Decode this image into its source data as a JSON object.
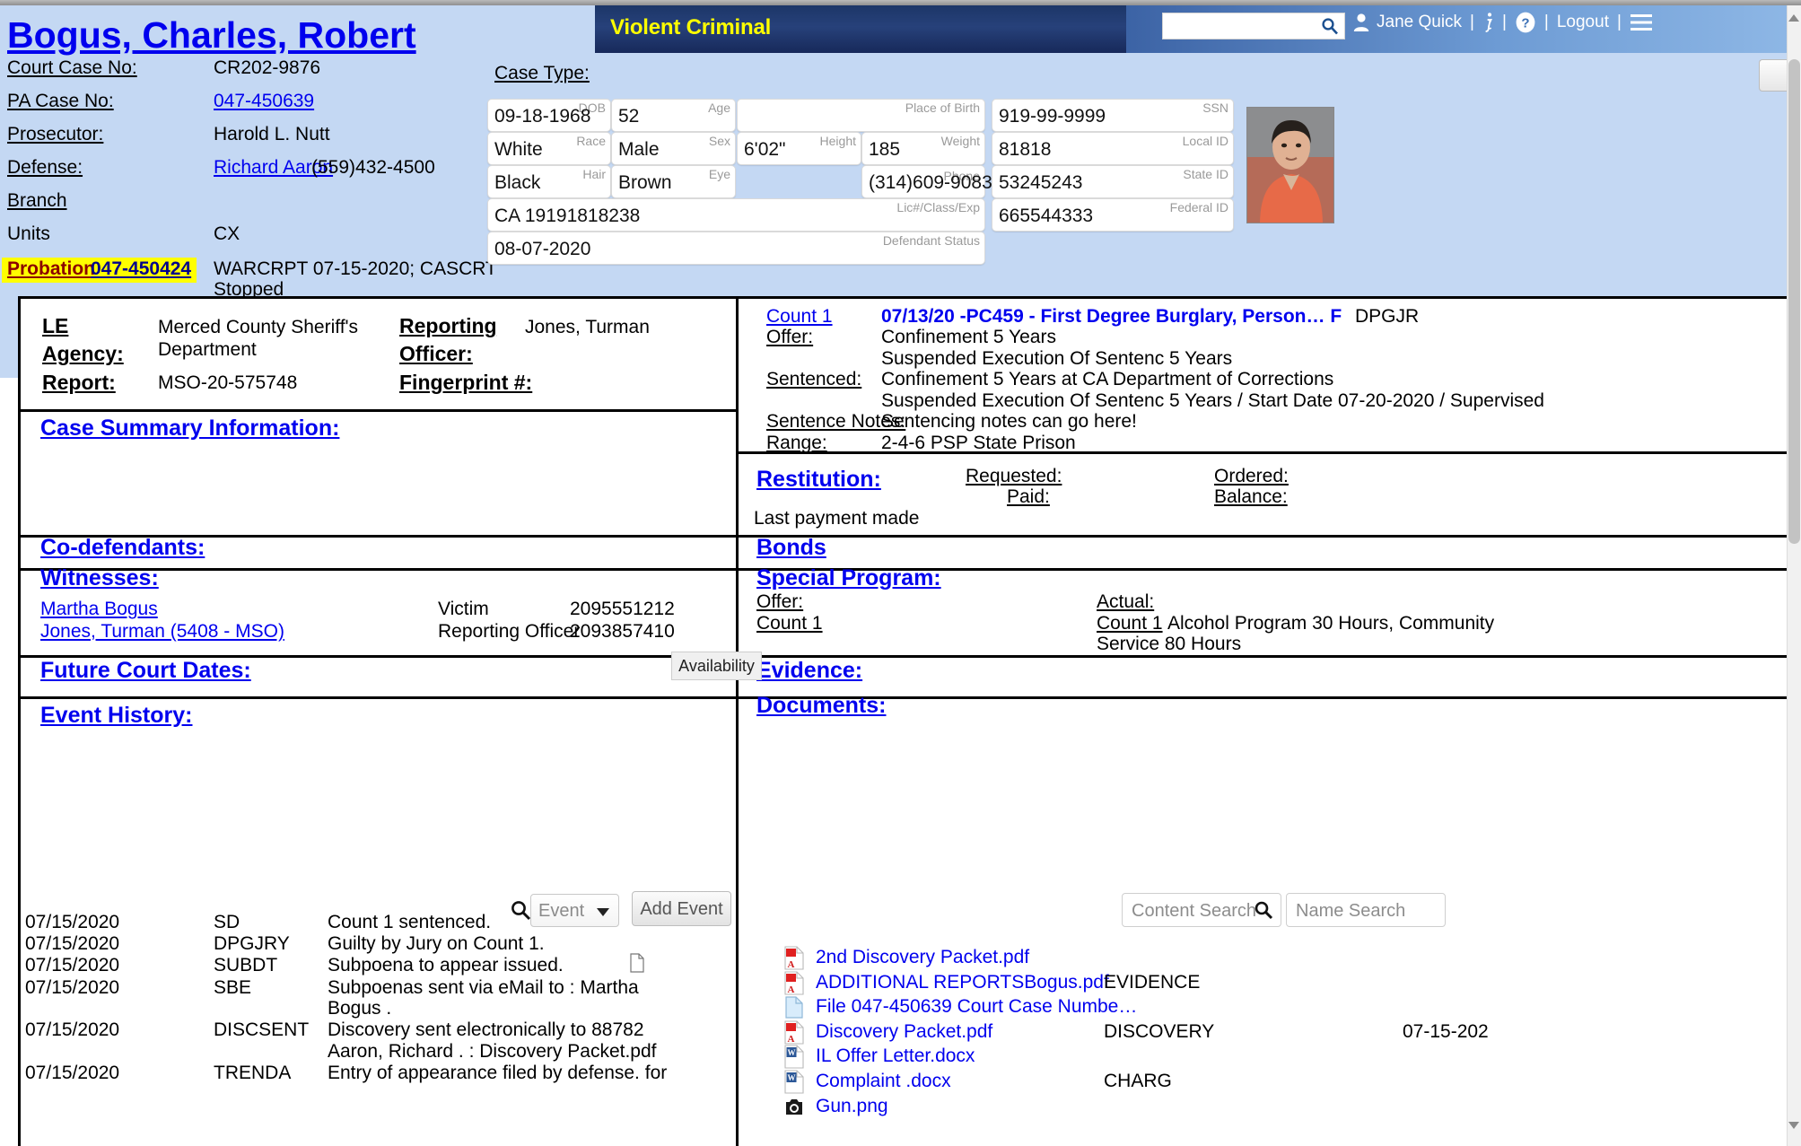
{
  "header": {
    "banner_label": "Violent Criminal",
    "search_placeholder": "",
    "search_value": "",
    "user_name": "Jane Quick",
    "logout_label": "Logout",
    "sep": "|",
    "icons": {
      "search": "search-icon",
      "person": "person-icon",
      "info": "info-icon",
      "help": "help-icon",
      "menu": "hamburger-menu-icon"
    }
  },
  "defendant": {
    "name": "Bogus, Charles, Robert",
    "labels": {
      "court_case_no": "Court Case No:",
      "pa_case_no": "PA Case No:",
      "prosecutor": "Prosecutor:",
      "defense": "Defense:",
      "branch": "Branch",
      "units": "Units",
      "probation": "Probation"
    },
    "values": {
      "court_case_no": "CR202-9876",
      "pa_case_no": "047-450639",
      "prosecutor": "Harold L. Nutt",
      "defense_name": "Richard Aaron",
      "defense_phone": "(559)432-4500",
      "branch": "",
      "units": "CX",
      "probation_no": "047-450424",
      "probation_note_line1": "WARCRPT 07-15-2020; CASCRT",
      "probation_note_line2": "Stopped"
    }
  },
  "case_type": {
    "label": "Case Type:",
    "value": ""
  },
  "demographics": [
    {
      "label": "DOB",
      "value": "09-18-1968"
    },
    {
      "label": "Age",
      "value": "52"
    },
    {
      "label": "Place of Birth",
      "value": ""
    },
    {
      "label": "SSN",
      "value": "919-99-9999"
    },
    {
      "label": "Race",
      "value": "White"
    },
    {
      "label": "Sex",
      "value": "Male"
    },
    {
      "label": "Height",
      "value": "6'02\""
    },
    {
      "label": "Weight",
      "value": "185"
    },
    {
      "label": "Local ID",
      "value": "81818"
    },
    {
      "label": "Hair",
      "value": "Black"
    },
    {
      "label": "Eye",
      "value": "Brown"
    },
    {
      "label": "Phone",
      "value": "(314)609-9083"
    },
    {
      "label": "State ID",
      "value": "53245243"
    },
    {
      "label": "Lic#/Class/Exp",
      "value": "CA 19191818238"
    },
    {
      "label": "Federal ID",
      "value": "665544333"
    },
    {
      "label": "Defendant Status",
      "value": "08-07-2020"
    }
  ],
  "le": {
    "agency_label": "LE Agency:",
    "agency_label_line1": "LE",
    "agency_label_line2": "Agency:",
    "agency_value_line1": "Merced County Sheriff's",
    "agency_value_line2": "Department",
    "report_label": "Report:",
    "report_value": "MSO-20-575748",
    "officer_label_line1": "Reporting",
    "officer_label_line2": "Officer:",
    "officer_value": "Jones, Turman",
    "fingerprint_label": "Fingerprint #:",
    "fingerprint_value": ""
  },
  "case_summary": {
    "heading": "Case Summary Information:",
    "body": ""
  },
  "counts": {
    "count_label": "Count 1",
    "charge": "07/13/20 -PC459 - First Degree Burglary, Person…  F",
    "charge_code": "DPGJR",
    "offer_label": "Offer:",
    "offer_line1": "Confinement 5 Years",
    "offer_line2": "Suspended Execution Of Sentenc 5 Years",
    "sentenced_label": "Sentenced:",
    "sentenced_line1": "Confinement 5 Years at CA Department of Corrections",
    "sentenced_line2": "Suspended Execution Of Sentenc 5 Years / Start Date 07-20-2020 / Supervised",
    "sentence_notes_label": "Sentence Notes:",
    "sentence_notes_value": "Sentencing notes can go here!",
    "range_label": "Range:",
    "range_value": "2-4-6 PSP State Prison"
  },
  "restitution": {
    "heading": "Restitution:",
    "requested_label": "Requested:",
    "ordered_label": "Ordered:",
    "paid_label": "Paid:",
    "balance_label": "Balance:",
    "last_payment_text": "Last payment made",
    "requested_value": "",
    "ordered_value": "",
    "paid_value": "",
    "balance_value": ""
  },
  "codefendants": {
    "heading": "Co-defendants:",
    "rows": []
  },
  "bonds": {
    "heading": "Bonds",
    "rows": []
  },
  "witnesses": {
    "heading": "Witnesses:",
    "rows": [
      {
        "name": "Martha Bogus",
        "role": "Victim",
        "phone": "2095551212"
      },
      {
        "name": "Jones, Turman (5408 - MSO)",
        "role": "Reporting Officer",
        "phone": "2093857410"
      }
    ]
  },
  "special_program": {
    "heading": "Special Program:",
    "offer_label": "Offer:",
    "actual_label": "Actual:",
    "offer_count": "Count 1",
    "actual_count": "Count 1",
    "actual_text_line1": "Alcohol Program 30 Hours, Community",
    "actual_text_line2": "Service 80 Hours"
  },
  "future_court_dates": {
    "heading": "Future Court Dates:"
  },
  "evidence": {
    "heading": "Evidence:"
  },
  "availability_tooltip": "Availability",
  "event_history": {
    "heading": "Event History:",
    "search_icon": "search-icon",
    "select_placeholder": "Event",
    "add_button": "Add Event",
    "rows": [
      {
        "date": "07/15/2020",
        "code": "SD",
        "desc": "Count 1 sentenced.",
        "desc2": "",
        "has_doc": false
      },
      {
        "date": "07/15/2020",
        "code": "DPGJRY",
        "desc": "Guilty by Jury on Count 1.",
        "desc2": "",
        "has_doc": false
      },
      {
        "date": "07/15/2020",
        "code": "SUBDT",
        "desc": "Subpoena to appear issued.",
        "desc2": "",
        "has_doc": true
      },
      {
        "date": "07/15/2020",
        "code": "SBE",
        "desc": "Subpoenas sent via eMail to : Martha",
        "desc2": "Bogus .",
        "has_doc": false
      },
      {
        "date": "07/15/2020",
        "code": "DISCSENT",
        "desc": "Discovery sent electronically to 88782",
        "desc2": "Aaron, Richard . : Discovery Packet.pdf",
        "has_doc": false
      },
      {
        "date": "07/15/2020",
        "code": "TRENDA",
        "desc": "Entry of appearance filed by defense. for",
        "desc2": "",
        "has_doc": false
      }
    ]
  },
  "documents": {
    "heading": "Documents:",
    "content_search_placeholder": "Content Search",
    "name_search_placeholder": "Name Search",
    "rows": [
      {
        "icon": "pdf-icon",
        "name": "2nd Discovery Packet.pdf",
        "category": "",
        "date": ""
      },
      {
        "icon": "pdf-icon",
        "name": "ADDITIONAL REPORTSBogus.pdf",
        "category": "EVIDENCE",
        "date": ""
      },
      {
        "icon": "file-icon",
        "name": "File 047-450639 Court Case Numbe…",
        "category": "",
        "date": ""
      },
      {
        "icon": "pdf-icon",
        "name": "Discovery Packet.pdf",
        "category": "DISCOVERY",
        "date": "07-15-202"
      },
      {
        "icon": "word-icon",
        "name": "IL Offer Letter.docx",
        "category": "",
        "date": ""
      },
      {
        "icon": "word-icon",
        "name": "Complaint .docx",
        "category": "CHARG",
        "date": ""
      },
      {
        "icon": "image-icon",
        "name": "Gun.png",
        "category": "",
        "date": ""
      }
    ]
  },
  "colors": {
    "link_blue": "#0000ee",
    "header_navy": "#1c3668",
    "banner_yellow": "#ffff00",
    "page_blue": "#c4d8f3",
    "highlight_yellow": "#ffff00",
    "probation_red": "#8b0000"
  }
}
